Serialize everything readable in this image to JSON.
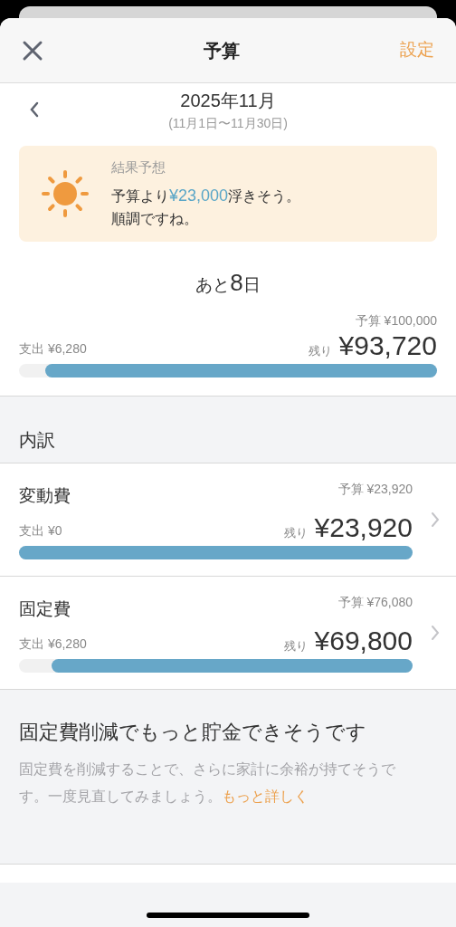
{
  "header": {
    "title": "予算",
    "action": "設定"
  },
  "period": {
    "month": "2025年11月",
    "range": "(11月1日〜11月30日)"
  },
  "forecast": {
    "label": "結果予想",
    "line_prefix": "予算より",
    "amount": "¥23,000",
    "line_suffix": "浮きそう。",
    "line2": "順調ですね。"
  },
  "days_left": {
    "prefix": "あと",
    "number": "8",
    "suffix": "日"
  },
  "total": {
    "budget": "予算 ¥100,000",
    "spent_label": "支出",
    "spent": "¥6,280",
    "remaining_label": "残り",
    "remaining": "¥93,720",
    "level": 0.937
  },
  "breakdown": {
    "title": "内訳",
    "rows": [
      {
        "name": "変動費",
        "budget": "予算 ¥23,920",
        "spent_label": "支出",
        "spent": "¥0",
        "remaining_label": "残り",
        "remaining": "¥23,920",
        "level": 1.0
      },
      {
        "name": "固定費",
        "budget": "予算 ¥76,080",
        "spent_label": "支出",
        "spent": "¥6,280",
        "remaining_label": "残り",
        "remaining": "¥69,800",
        "level": 0.917
      }
    ]
  },
  "tip": {
    "title": "固定費削減でもっと貯金できそうです",
    "body": "固定費を削減することで、さらに家計に余裕が持てそうです。一度見直してみましょう。",
    "link": "もっと詳しく"
  }
}
